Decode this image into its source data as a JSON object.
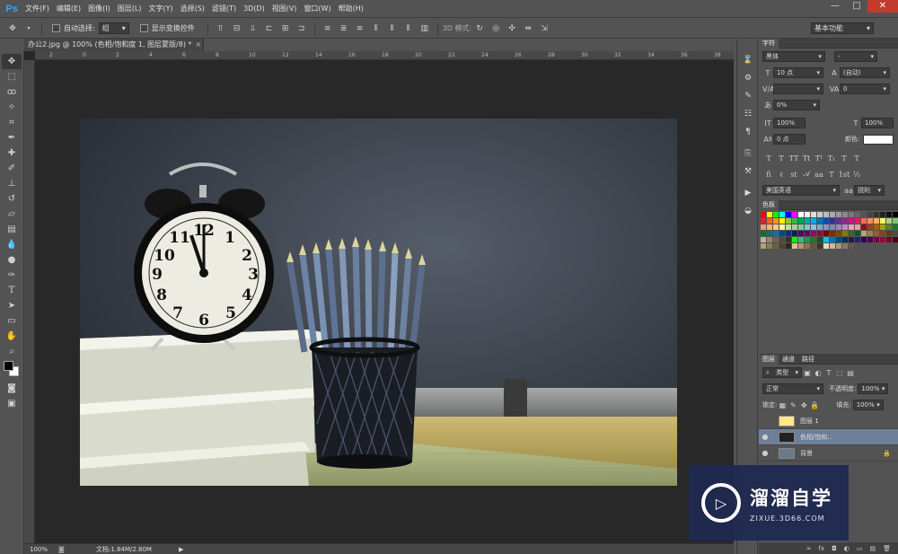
{
  "app": {
    "logo": "Ps",
    "accent": "#31a8ff"
  },
  "menu": [
    "文件(F)",
    "编辑(E)",
    "图像(I)",
    "图层(L)",
    "文字(Y)",
    "选择(S)",
    "滤镜(T)",
    "3D(D)",
    "视图(V)",
    "窗口(W)",
    "帮助(H)"
  ],
  "window_controls": {
    "minimize": "—",
    "maximize": "□",
    "close": "✕"
  },
  "options": {
    "auto_select_label": "自动选择:",
    "auto_select_value": "组",
    "show_transform_label": "显示变换控件",
    "mode_3d_label": "3D 模式:",
    "workspace": "基本功能"
  },
  "document": {
    "tab_title": "办公2.jpg @ 100% (色相/饱和度 1, 图层蒙版/8) *",
    "tab_close": "×",
    "zoom": "100%",
    "doc_size": "文档:1.84M/2.80M"
  },
  "rulers": {
    "top": [
      "2",
      "0",
      "2",
      "4",
      "6",
      "8",
      "10",
      "12",
      "14",
      "16",
      "18",
      "20",
      "22",
      "24",
      "26",
      "28",
      "30",
      "32",
      "34",
      "36",
      "38"
    ]
  },
  "character_panel": {
    "tab": "字符",
    "font_family": "黑体",
    "font_style": "-",
    "font_size": "10 点",
    "leading": "(自动)",
    "kerning": "",
    "tracking": "0",
    "tsume": "0%",
    "vertical_scale": "100%",
    "horizontal_scale": "100%",
    "baseline_shift": "0 点",
    "color_label": "颜色:",
    "color_value": "#ffffff",
    "styles": [
      "T",
      "T",
      "TT",
      "Tt",
      "T¹",
      "T₁",
      "T",
      "T"
    ],
    "language": "美国英语",
    "anti_alias": "锐利"
  },
  "swatches_panel": {
    "tab": "色板",
    "colors": [
      "#ff0000",
      "#ffff00",
      "#00ff00",
      "#00ffff",
      "#0000ff",
      "#ff00ff",
      "#ffffff",
      "#eeeeee",
      "#dddddd",
      "#cccccc",
      "#bbbbbb",
      "#aaaaaa",
      "#999999",
      "#888888",
      "#777777",
      "#666666",
      "#555555",
      "#444444",
      "#333333",
      "#222222",
      "#111111",
      "#000000",
      "#ed1c24",
      "#f26522",
      "#f7941d",
      "#fff200",
      "#8dc63f",
      "#39b54a",
      "#00a651",
      "#00a99d",
      "#00aeef",
      "#0072bc",
      "#0054a6",
      "#2e3192",
      "#662d91",
      "#92278f",
      "#ec008c",
      "#ed145b",
      "#f26c4f",
      "#f68e56",
      "#fbaf5d",
      "#fff568",
      "#acd373",
      "#7cc576",
      "#f7977a",
      "#f9ad81",
      "#fdc68a",
      "#fff79a",
      "#c4df9b",
      "#a3d39c",
      "#82ca9d",
      "#7accc8",
      "#6dcff6",
      "#7da7d9",
      "#8393ca",
      "#8781bd",
      "#a186be",
      "#bd8cbf",
      "#f49ac1",
      "#f6989d",
      "#9e0b0f",
      "#a0410d",
      "#a36209",
      "#aba000",
      "#598527",
      "#1a7b30",
      "#007236",
      "#00746b",
      "#0076a3",
      "#004a80",
      "#003471",
      "#1b1464",
      "#440e62",
      "#630460",
      "#9e005d",
      "#9e0039",
      "#790000",
      "#7b2e00",
      "#7d4900",
      "#827b00",
      "#406618",
      "#005e20",
      "#c69c6d",
      "#a67c52",
      "#8c6239",
      "#754c24",
      "#603913",
      "#534741",
      "#c7b299",
      "#998675",
      "#736357",
      "#534741",
      "#362f2d",
      "#00ff00",
      "#3cb878",
      "#00a651",
      "#197b30",
      "#005826",
      "#00bff3",
      "#0076a3",
      "#004b7b",
      "#002e5b",
      "#1a1f4b",
      "#25216f",
      "#32004b",
      "#4b0049",
      "#7b0046",
      "#9e0039",
      "#7a0026",
      "#4f0013",
      "#b4a06b",
      "#8b7d55",
      "#6b5f41",
      "#4a422d",
      "#2c271a",
      "#d9c39a",
      "#b79a6b",
      "#8f7552",
      "#68543b",
      "#403324",
      "#e8d8c0",
      "#c8b89c",
      "#a89880",
      "#887864",
      "#685848"
    ]
  },
  "layers_panel": {
    "tabs": [
      "图层",
      "通道",
      "路径"
    ],
    "filter": "类型",
    "blend_mode": "正常",
    "opacity_label": "不透明度:",
    "opacity": "100%",
    "lock_label": "锁定:",
    "fill_label": "填充:",
    "fill": "100%",
    "layers": [
      {
        "name": "图层 1",
        "visible": false,
        "thumb": "#ffe88a"
      },
      {
        "name": "色相/饱和...",
        "visible": true,
        "thumb": "#222222"
      },
      {
        "name": "背景",
        "visible": true,
        "thumb": "#6a7a8a"
      }
    ],
    "footer_icons": [
      "∞",
      "fx",
      "◘",
      "◐",
      "▭",
      "▤",
      "🗑"
    ]
  },
  "watermark": {
    "title": "溜溜自学",
    "url": "ZIXUE.3D66.COM"
  }
}
